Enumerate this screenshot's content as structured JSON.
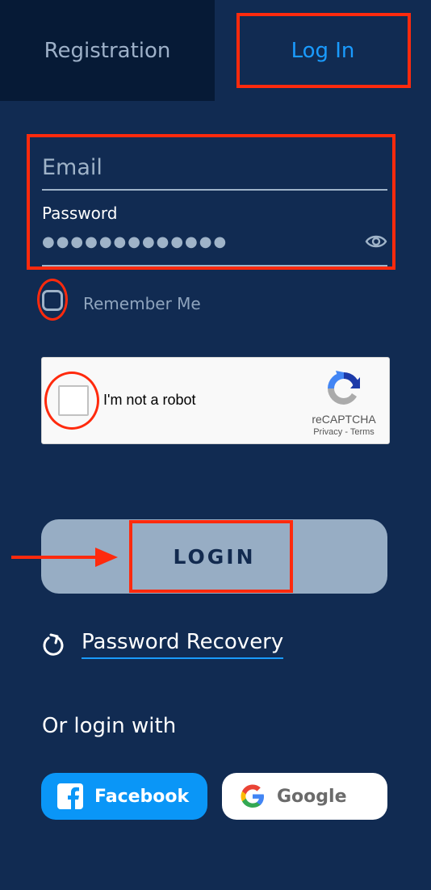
{
  "tabs": {
    "registration": "Registration",
    "login": "Log In"
  },
  "form": {
    "email_placeholder": "Email",
    "password_label": "Password",
    "password_value": "●●●●●●●●●●●●●",
    "remember_me": "Remember Me",
    "remember_checked": false
  },
  "recaptcha": {
    "label": "I'm not a robot",
    "brand": "reCAPTCHA",
    "links": "Privacy - Terms",
    "checked": false
  },
  "actions": {
    "login": "LOGIN",
    "password_recovery": "Password Recovery"
  },
  "social": {
    "heading": "Or login with",
    "facebook": "Facebook",
    "google": "Google"
  },
  "colors": {
    "background": "#112b52",
    "tab_inactive": "#061a36",
    "accent": "#1a9bff",
    "annotation": "#ff2a0d",
    "facebook": "#0a96f7",
    "login_button": "#97adc4"
  }
}
